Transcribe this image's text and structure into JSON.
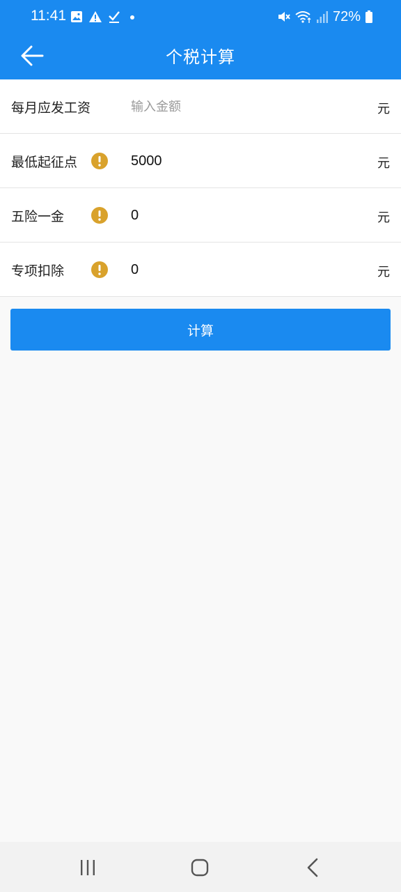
{
  "status_bar": {
    "time": "11:41",
    "battery": "72%",
    "left_icons": [
      "image-icon",
      "warning-icon",
      "check-icon",
      "dot-icon"
    ],
    "right_icons": [
      "mute-icon",
      "wifi-icon",
      "signal-icon",
      "battery-icon"
    ]
  },
  "app_bar": {
    "title": "个税计算",
    "back_icon": "arrow-left-icon",
    "background": "#1a8af0"
  },
  "form": {
    "rows": [
      {
        "label": "每月应发工资",
        "value": "",
        "placeholder": "输入金额",
        "unit": "元",
        "has_info": false
      },
      {
        "label": "最低起征点",
        "value": "5000",
        "placeholder": "",
        "unit": "元",
        "has_info": true
      },
      {
        "label": "五险一金",
        "value": "0",
        "placeholder": "",
        "unit": "元",
        "has_info": true
      },
      {
        "label": "专项扣除",
        "value": "0",
        "placeholder": "",
        "unit": "元",
        "has_info": true
      }
    ],
    "info_icon_color": "#d9a22c"
  },
  "calculate_button": {
    "label": "计算"
  },
  "nav_bar": {
    "icons": [
      "recent-apps-icon",
      "home-icon",
      "back-nav-icon"
    ]
  }
}
